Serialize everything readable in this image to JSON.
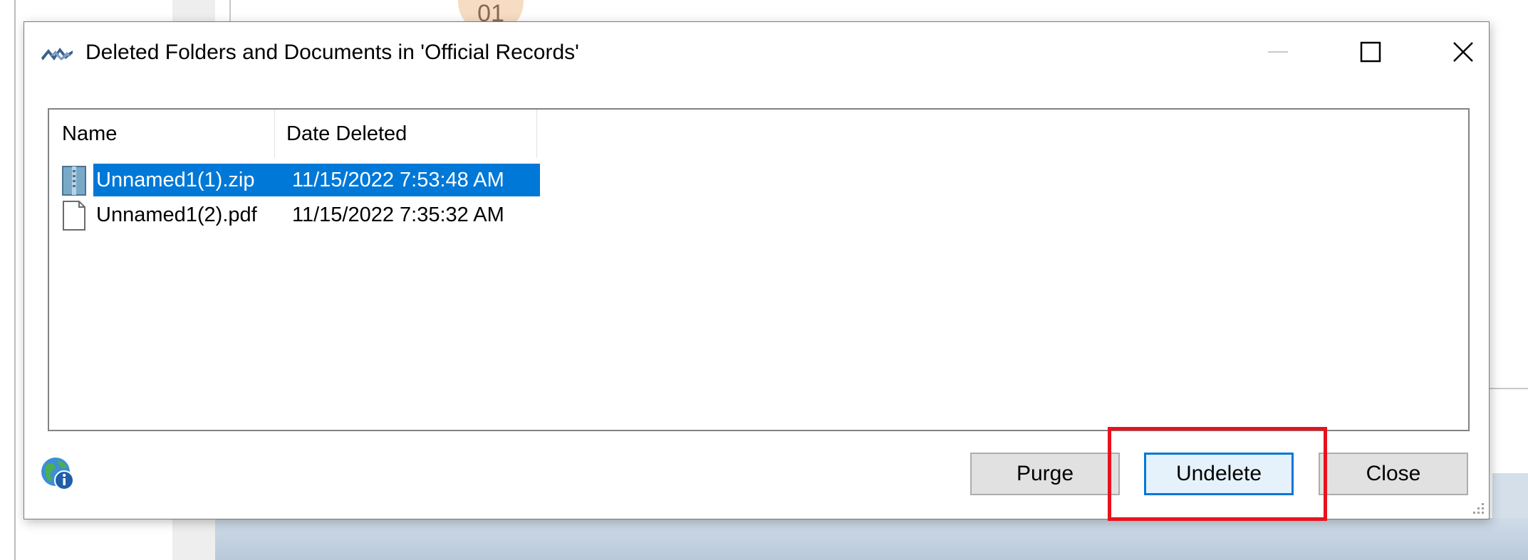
{
  "background": {
    "badge_text": "01"
  },
  "dialog": {
    "title": "Deleted Folders and Documents in 'Official Records'",
    "window_controls": {
      "minimize_icon": "minimize-icon",
      "maximize_icon": "maximize-icon",
      "close_icon": "close-icon"
    }
  },
  "list": {
    "columns": [
      "Name",
      "Date Deleted"
    ],
    "rows": [
      {
        "name": "Unnamed1(1).zip",
        "date_deleted": "11/15/2022 7:53:48 AM",
        "icon": "zip-file-icon",
        "selected": true
      },
      {
        "name": "Unnamed1(2).pdf",
        "date_deleted": "11/15/2022 7:35:32 AM",
        "icon": "document-file-icon",
        "selected": false
      }
    ]
  },
  "buttons": {
    "purge": "Purge",
    "undelete": "Undelete",
    "close": "Close"
  },
  "colors": {
    "selection": "#0078d7",
    "highlight": "#e8121b",
    "default_button_border": "#0078d7"
  }
}
